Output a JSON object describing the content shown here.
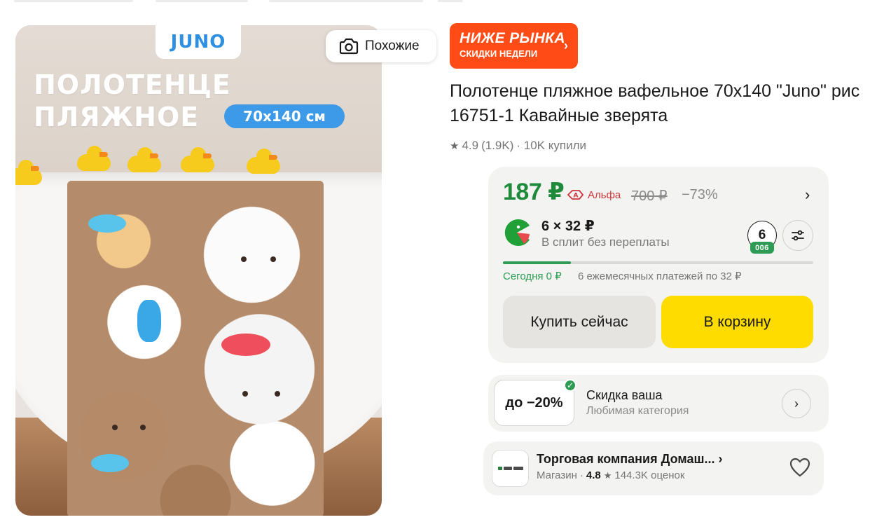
{
  "image": {
    "brand": "JUNO",
    "heading_line1": "ПОЛОТЕНЦЕ",
    "heading_line2": "ПЛЯЖНОЕ",
    "size_label": "70x140 см",
    "similar_label": "Похожие"
  },
  "promo": {
    "title": "НИЖЕ РЫНКА",
    "subtitle": "СКИДКИ НЕДЕЛИ"
  },
  "product": {
    "title": "Полотенце пляжное вафельное 70х140 \"Juno\" рис 16751-1 Кавайные зверята",
    "rating": "4.9",
    "reviews": "(1.9K)",
    "bought": "· 10K купили"
  },
  "price": {
    "current": "187 ₽",
    "bank": "Альфа",
    "old": "700 ₽",
    "discount": "−73%"
  },
  "split": {
    "amount": "6 × 32 ₽",
    "subtitle": "В сплит без переплаты",
    "count": "6",
    "badge": "006",
    "today": "Сегодня 0 ₽",
    "monthly": "6 ежемесячных платежей по 32 ₽",
    "progress_fraction": 0.22
  },
  "actions": {
    "buy_now": "Купить сейчас",
    "add_to_cart": "В корзину"
  },
  "personal_discount": {
    "badge": "до −20%",
    "title": "Скидка ваша",
    "subtitle": "Любимая категория"
  },
  "shop": {
    "name": "Торговая компания Домаш...",
    "type": "Магазин",
    "separator": "·",
    "rating": "4.8",
    "reviews": "144.3K оценок"
  },
  "colors": {
    "accent_green": "#1f8a3b",
    "cart_yellow": "#ffdc00",
    "promo_orange": "#ff4b16",
    "alfa_red": "#d1333b"
  }
}
